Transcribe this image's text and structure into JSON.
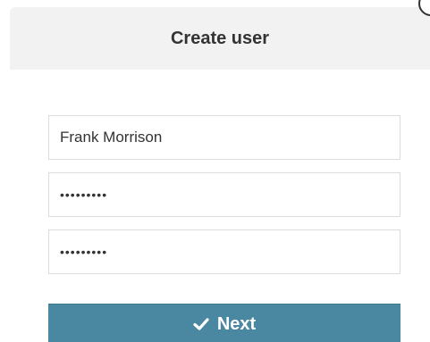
{
  "dialog": {
    "title": "Create user"
  },
  "form": {
    "name_value": "Frank Morrison",
    "password_value": "•••••••••",
    "confirm_password_value": "•••••••••"
  },
  "actions": {
    "next_label": "Next",
    "next_icon": "check-icon"
  },
  "colors": {
    "header_bg": "#f2f2f2",
    "primary_button": "#4a87a0",
    "field_border": "#dcdcdc"
  }
}
